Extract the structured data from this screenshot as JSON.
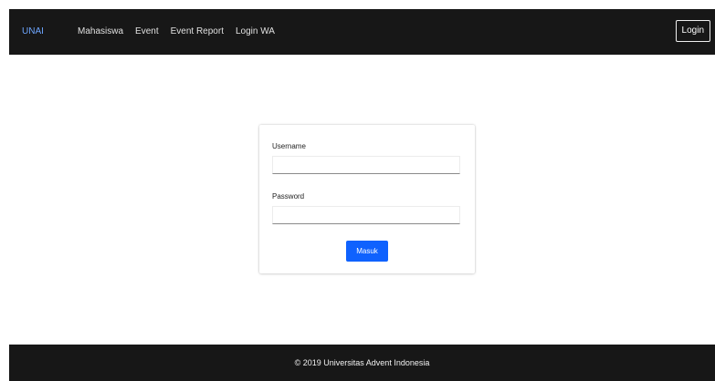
{
  "navbar": {
    "brand": "UNAI",
    "links": [
      {
        "label": "Mahasiswa"
      },
      {
        "label": "Event"
      },
      {
        "label": "Event Report"
      },
      {
        "label": "Login WA"
      }
    ],
    "login_label": "Login"
  },
  "login_form": {
    "username_label": "Username",
    "username_value": "",
    "password_label": "Password",
    "password_value": "",
    "submit_label": "Masuk"
  },
  "footer": {
    "text": "© 2019 Universitas Advent Indonesia"
  },
  "colors": {
    "navbar_bg": "#171717",
    "brand_link": "#6ea6ff",
    "primary_button": "#0f62fe",
    "footer_bg": "#171717"
  }
}
